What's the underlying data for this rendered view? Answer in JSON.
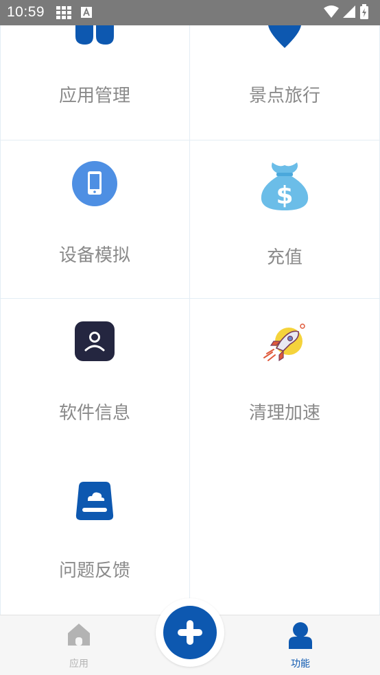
{
  "status_bar": {
    "time": "10:59"
  },
  "colors": {
    "accent": "#0d58b0",
    "label_gray": "#8a8a8a",
    "tab_inactive": "#b3b3b3"
  },
  "grid": {
    "items": [
      {
        "label": "应用管理",
        "icon": "app-management-icon"
      },
      {
        "label": "景点旅行",
        "icon": "location-pin-icon"
      },
      {
        "label": "设备模拟",
        "icon": "phone-icon"
      },
      {
        "label": "充值",
        "icon": "money-bag-icon"
      },
      {
        "label": "软件信息",
        "icon": "user-profile-icon"
      },
      {
        "label": "清理加速",
        "icon": "rocket-icon"
      },
      {
        "label": "问题反馈",
        "icon": "cloud-feedback-icon"
      }
    ]
  },
  "bottom_nav": {
    "tabs": [
      {
        "label": "应用",
        "icon": "home-icon",
        "active": false
      },
      {
        "label": "功能",
        "icon": "person-icon",
        "active": true
      }
    ],
    "fab_icon": "plus-icon"
  }
}
